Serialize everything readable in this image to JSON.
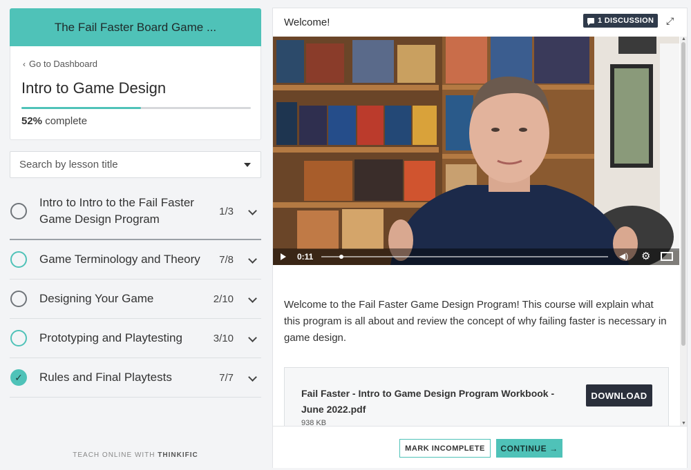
{
  "sidebar": {
    "course_header": "The Fail Faster Board Game ...",
    "back_link": "Go to Dashboard",
    "course_title": "Intro to Game Design",
    "progress_percent": "52%",
    "progress_fraction": 0.52,
    "progress_suffix": "complete",
    "search_placeholder": "Search by lesson title",
    "chapters": [
      {
        "title": "Intro to Intro to the Fail Faster Game Design Program",
        "count": "1/3",
        "status": "not-started"
      },
      {
        "title": "Game Terminology and Theory",
        "count": "7/8",
        "status": "in-progress"
      },
      {
        "title": "Designing Your Game",
        "count": "2/10",
        "status": "not-started"
      },
      {
        "title": "Prototyping and Playtesting",
        "count": "3/10",
        "status": "in-progress"
      },
      {
        "title": "Rules and Final Playtests",
        "count": "7/7",
        "status": "complete"
      }
    ],
    "branding_prefix": "TEACH ONLINE WITH",
    "branding_brand": "THINKIFIC"
  },
  "main": {
    "lesson_title": "Welcome!",
    "discussion_badge": "1 DISCUSSION",
    "video": {
      "time": "0:11",
      "progress_fraction": 0.07
    },
    "description": "Welcome to the Fail Faster Game Design Program! This course will explain what this program is all about and review the concept of why failing faster is necessary in game design.",
    "attachment": {
      "name": "Fail Faster - Intro to Game Design Program Workbook - June 2022.pdf",
      "size": "938 KB",
      "download_label": "DOWNLOAD"
    },
    "footer": {
      "mark_incomplete": "MARK INCOMPLETE",
      "continue": "CONTINUE"
    }
  },
  "colors": {
    "accent": "#4fc2b8",
    "dark_button": "#2a2f3b",
    "badge": "#2f3a4a"
  }
}
